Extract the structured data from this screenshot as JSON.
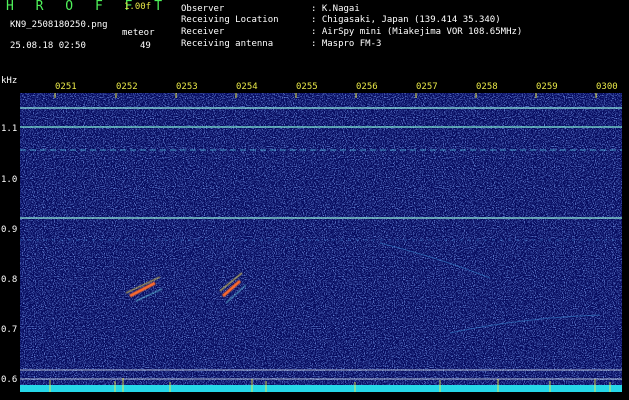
{
  "header": {
    "app_title": "H R O F F T",
    "version": "1.00f",
    "file_name": "KN9_2508180250.png",
    "meteor_label": "meteor",
    "meteor_count": "49",
    "datetime": "25.08.18 02:50"
  },
  "info": [
    {
      "key": "Observer",
      "value": ": K.Nagai"
    },
    {
      "key": "Receiving Location",
      "value": ": Chigasaki, Japan (139.414 35.340)"
    },
    {
      "key": "Receiver",
      "value": ": AirSpy mini (Miakejima VOR 108.65MHz)"
    },
    {
      "key": "Receiving antenna",
      "value": ": Maspro FM-3"
    }
  ],
  "colors": {
    "background": "#050a5e",
    "x_tick": "#e8e848",
    "title": "#4ff25a"
  },
  "spectrogram": {
    "y_unit": "kHz",
    "y_ticks": [
      "1.1",
      "1.0",
      "0.9",
      "0.8",
      "0.7",
      "0.6"
    ],
    "x_ticks": [
      "0251",
      "0252",
      "0253",
      "0254",
      "0255",
      "0256",
      "0257",
      "0258",
      "0259",
      "0300"
    ]
  }
}
